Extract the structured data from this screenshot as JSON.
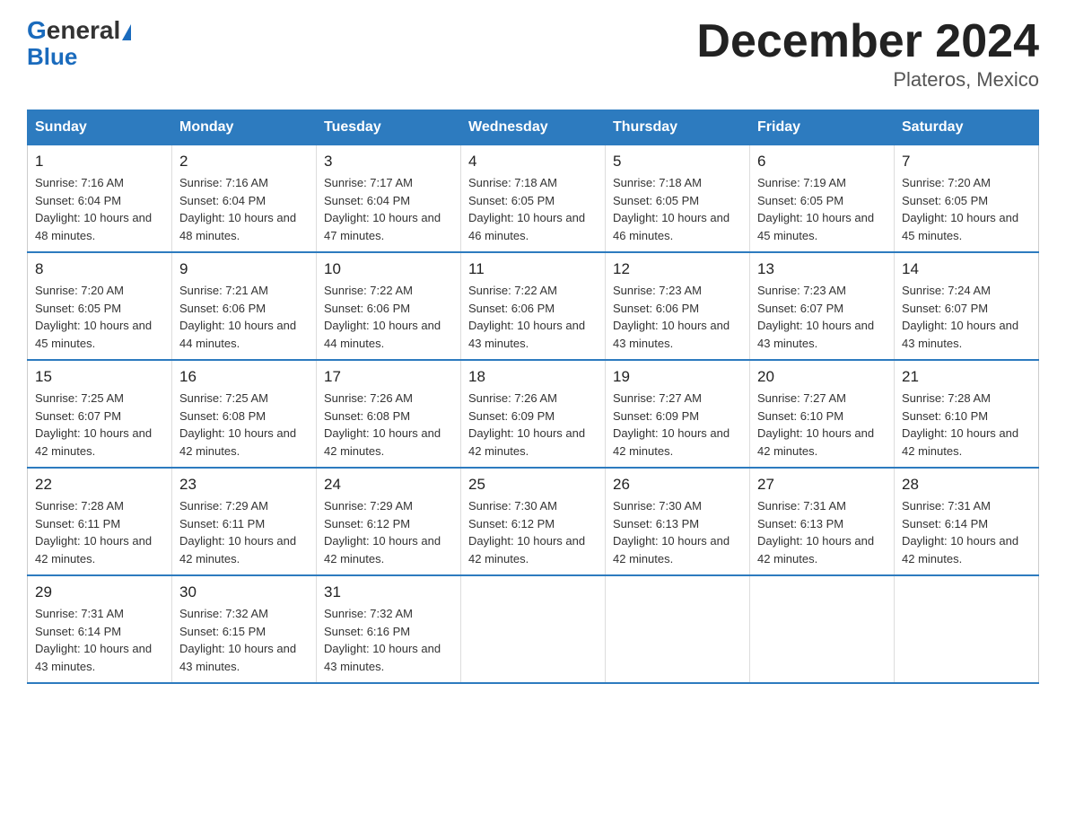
{
  "header": {
    "logo_general": "General",
    "logo_blue": "Blue",
    "month_title": "December 2024",
    "location": "Plateros, Mexico"
  },
  "days_of_week": [
    "Sunday",
    "Monday",
    "Tuesday",
    "Wednesday",
    "Thursday",
    "Friday",
    "Saturday"
  ],
  "weeks": [
    [
      {
        "day": "1",
        "sunrise": "7:16 AM",
        "sunset": "6:04 PM",
        "daylight": "10 hours and 48 minutes."
      },
      {
        "day": "2",
        "sunrise": "7:16 AM",
        "sunset": "6:04 PM",
        "daylight": "10 hours and 48 minutes."
      },
      {
        "day": "3",
        "sunrise": "7:17 AM",
        "sunset": "6:04 PM",
        "daylight": "10 hours and 47 minutes."
      },
      {
        "day": "4",
        "sunrise": "7:18 AM",
        "sunset": "6:05 PM",
        "daylight": "10 hours and 46 minutes."
      },
      {
        "day": "5",
        "sunrise": "7:18 AM",
        "sunset": "6:05 PM",
        "daylight": "10 hours and 46 minutes."
      },
      {
        "day": "6",
        "sunrise": "7:19 AM",
        "sunset": "6:05 PM",
        "daylight": "10 hours and 45 minutes."
      },
      {
        "day": "7",
        "sunrise": "7:20 AM",
        "sunset": "6:05 PM",
        "daylight": "10 hours and 45 minutes."
      }
    ],
    [
      {
        "day": "8",
        "sunrise": "7:20 AM",
        "sunset": "6:05 PM",
        "daylight": "10 hours and 45 minutes."
      },
      {
        "day": "9",
        "sunrise": "7:21 AM",
        "sunset": "6:06 PM",
        "daylight": "10 hours and 44 minutes."
      },
      {
        "day": "10",
        "sunrise": "7:22 AM",
        "sunset": "6:06 PM",
        "daylight": "10 hours and 44 minutes."
      },
      {
        "day": "11",
        "sunrise": "7:22 AM",
        "sunset": "6:06 PM",
        "daylight": "10 hours and 43 minutes."
      },
      {
        "day": "12",
        "sunrise": "7:23 AM",
        "sunset": "6:06 PM",
        "daylight": "10 hours and 43 minutes."
      },
      {
        "day": "13",
        "sunrise": "7:23 AM",
        "sunset": "6:07 PM",
        "daylight": "10 hours and 43 minutes."
      },
      {
        "day": "14",
        "sunrise": "7:24 AM",
        "sunset": "6:07 PM",
        "daylight": "10 hours and 43 minutes."
      }
    ],
    [
      {
        "day": "15",
        "sunrise": "7:25 AM",
        "sunset": "6:07 PM",
        "daylight": "10 hours and 42 minutes."
      },
      {
        "day": "16",
        "sunrise": "7:25 AM",
        "sunset": "6:08 PM",
        "daylight": "10 hours and 42 minutes."
      },
      {
        "day": "17",
        "sunrise": "7:26 AM",
        "sunset": "6:08 PM",
        "daylight": "10 hours and 42 minutes."
      },
      {
        "day": "18",
        "sunrise": "7:26 AM",
        "sunset": "6:09 PM",
        "daylight": "10 hours and 42 minutes."
      },
      {
        "day": "19",
        "sunrise": "7:27 AM",
        "sunset": "6:09 PM",
        "daylight": "10 hours and 42 minutes."
      },
      {
        "day": "20",
        "sunrise": "7:27 AM",
        "sunset": "6:10 PM",
        "daylight": "10 hours and 42 minutes."
      },
      {
        "day": "21",
        "sunrise": "7:28 AM",
        "sunset": "6:10 PM",
        "daylight": "10 hours and 42 minutes."
      }
    ],
    [
      {
        "day": "22",
        "sunrise": "7:28 AM",
        "sunset": "6:11 PM",
        "daylight": "10 hours and 42 minutes."
      },
      {
        "day": "23",
        "sunrise": "7:29 AM",
        "sunset": "6:11 PM",
        "daylight": "10 hours and 42 minutes."
      },
      {
        "day": "24",
        "sunrise": "7:29 AM",
        "sunset": "6:12 PM",
        "daylight": "10 hours and 42 minutes."
      },
      {
        "day": "25",
        "sunrise": "7:30 AM",
        "sunset": "6:12 PM",
        "daylight": "10 hours and 42 minutes."
      },
      {
        "day": "26",
        "sunrise": "7:30 AM",
        "sunset": "6:13 PM",
        "daylight": "10 hours and 42 minutes."
      },
      {
        "day": "27",
        "sunrise": "7:31 AM",
        "sunset": "6:13 PM",
        "daylight": "10 hours and 42 minutes."
      },
      {
        "day": "28",
        "sunrise": "7:31 AM",
        "sunset": "6:14 PM",
        "daylight": "10 hours and 42 minutes."
      }
    ],
    [
      {
        "day": "29",
        "sunrise": "7:31 AM",
        "sunset": "6:14 PM",
        "daylight": "10 hours and 43 minutes."
      },
      {
        "day": "30",
        "sunrise": "7:32 AM",
        "sunset": "6:15 PM",
        "daylight": "10 hours and 43 minutes."
      },
      {
        "day": "31",
        "sunrise": "7:32 AM",
        "sunset": "6:16 PM",
        "daylight": "10 hours and 43 minutes."
      },
      {
        "day": "",
        "sunrise": "",
        "sunset": "",
        "daylight": ""
      },
      {
        "day": "",
        "sunrise": "",
        "sunset": "",
        "daylight": ""
      },
      {
        "day": "",
        "sunrise": "",
        "sunset": "",
        "daylight": ""
      },
      {
        "day": "",
        "sunrise": "",
        "sunset": "",
        "daylight": ""
      }
    ]
  ],
  "colors": {
    "header_bg": "#2d7bbf",
    "header_text": "#ffffff",
    "border": "#2d7bbf",
    "logo_blue": "#1a6bbd"
  }
}
